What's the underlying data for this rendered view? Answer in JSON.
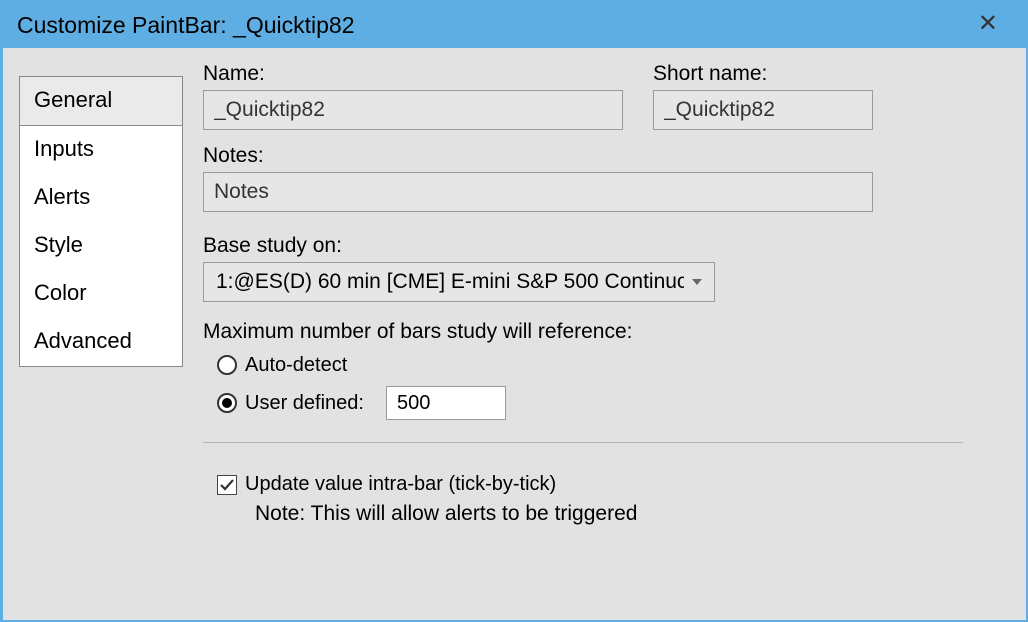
{
  "window": {
    "title": "Customize PaintBar: _Quicktip82"
  },
  "tabs": {
    "items": [
      {
        "label": "General"
      },
      {
        "label": "Inputs"
      },
      {
        "label": "Alerts"
      },
      {
        "label": "Style"
      },
      {
        "label": "Color"
      },
      {
        "label": "Advanced"
      }
    ],
    "active_index": 0
  },
  "general": {
    "name_label": "Name:",
    "name_value": "_Quicktip82",
    "short_name_label": "Short name:",
    "short_name_value": "_Quicktip82",
    "notes_label": "Notes:",
    "notes_value": "Notes",
    "base_study_label": "Base study on:",
    "base_study_value": "1:@ES(D) 60 min [CME] E-mini S&P 500 Continuc",
    "max_bars_label": "Maximum number of bars study will reference:",
    "auto_detect_label": "Auto-detect",
    "user_defined_label": "User defined:",
    "user_defined_value": "500",
    "bars_mode": "user_defined",
    "update_intrabar_checked": true,
    "update_intrabar_label": "Update value intra-bar (tick-by-tick)",
    "update_intrabar_note": "Note: This will allow alerts to be triggered"
  }
}
